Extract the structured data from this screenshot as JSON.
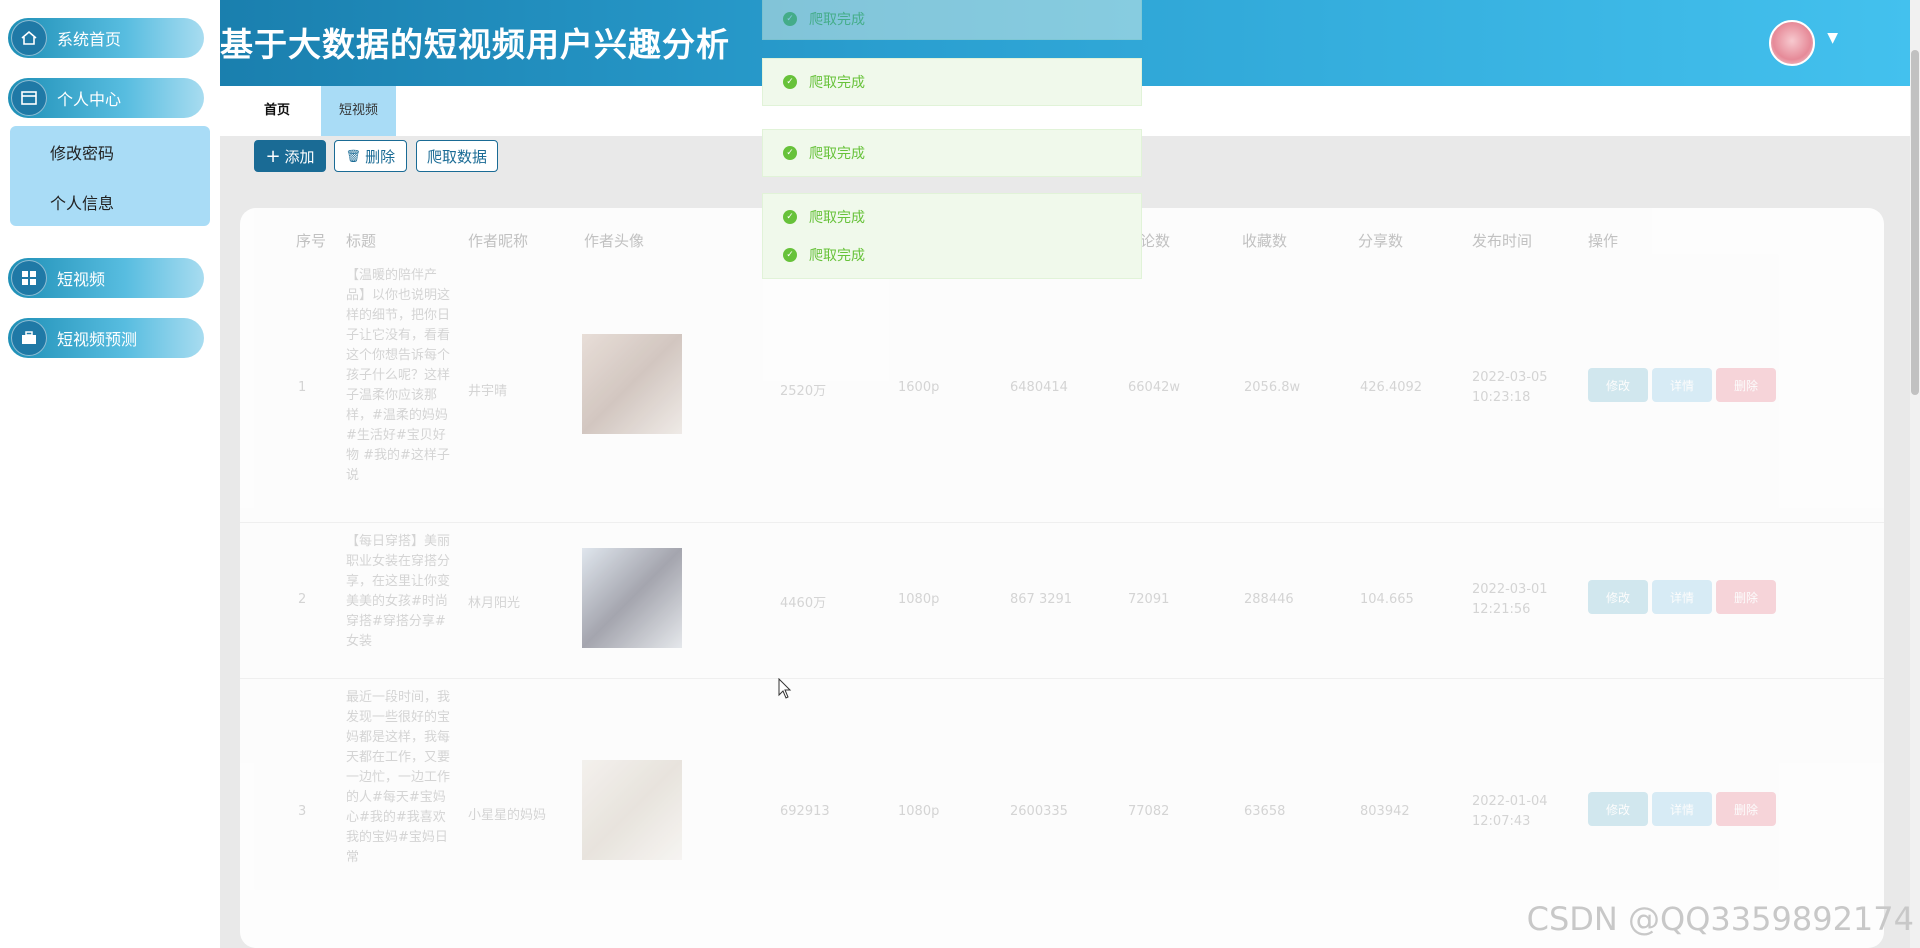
{
  "sidebar": {
    "items": [
      {
        "label": "系统首页",
        "icon": "home-icon"
      },
      {
        "label": "个人中心",
        "icon": "calendar-icon"
      },
      {
        "label": "短视频",
        "icon": "grid-icon"
      },
      {
        "label": "短视频预测",
        "icon": "briefcase-icon"
      }
    ],
    "submenu": [
      "修改密码",
      "个人信息"
    ]
  },
  "header": {
    "title": "基于大数据的短视频用户兴趣分析"
  },
  "tabs": [
    "首页",
    "短视频"
  ],
  "toolbar": {
    "add_label": "添加",
    "delete_label": "删除",
    "crawl_label": "爬取数据"
  },
  "table": {
    "headers": [
      "序号",
      "标题",
      "作者昵称",
      "作者头像",
      "",
      "",
      "",
      "论数",
      "收藏数",
      "分享数",
      "发布时间",
      "操作"
    ],
    "rows": [
      {
        "index": "1",
        "title": "【温暖的陪伴产品】以你也说明这样的细节，把你日子让它没有，看看这个你想告诉每个孩子什么呢？这样子温柔你应该那样，#温柔的妈妈#生活好#宝贝好物 #我的#这样子说",
        "author": "井宇晴",
        "c1": "2520万",
        "c2": "1600p",
        "c3": "6480414",
        "c4": "66042w",
        "c5": "2056.8w",
        "c6": "426.4092",
        "time": "2022-03-05 10:23:18"
      },
      {
        "index": "2",
        "title": "【每日穿搭】美丽职业女装在穿搭分享，在这里让你变美美的女孩#时尚穿搭#穿搭分享#女装",
        "author": "林月阳光",
        "c1": "4460万",
        "c2": "1080p",
        "c3": "867 3291",
        "c4": "72091",
        "c5": "288446",
        "c6": "104.665",
        "time": "2022-03-01 12:21:56"
      },
      {
        "index": "3",
        "title": "最近一段时间，我发现一些很好的宝妈都是这样，我每天都在工作，又要一边忙，一边工作的人#每天#宝妈心#我的#我喜欢我的宝妈#宝妈日常",
        "author": "小星星的妈妈",
        "c1": "692913",
        "c2": "1080p",
        "c3": "2600335",
        "c4": "77082",
        "c5": "63658",
        "c6": "803942",
        "time": "2022-01-04 12:07:43"
      }
    ],
    "ops": [
      "修改",
      "详情",
      "删除"
    ]
  },
  "toasts": [
    "爬取完成",
    "爬取完成",
    "爬取完成",
    "爬取完成",
    "爬取完成"
  ],
  "watermark": "CSDN @QQ3359892174"
}
